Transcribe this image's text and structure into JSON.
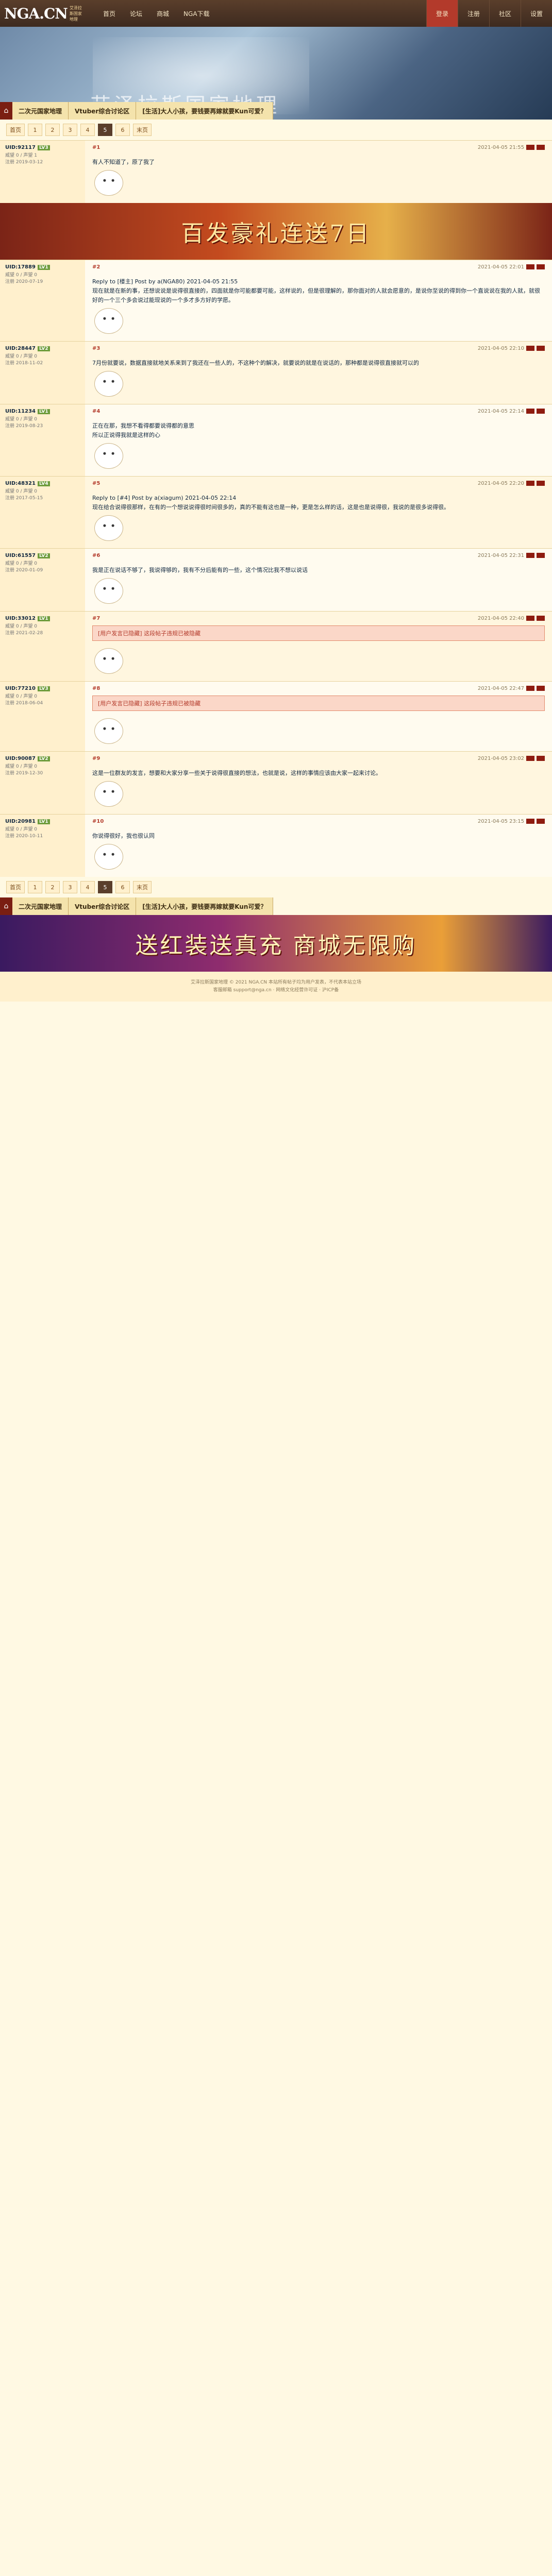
{
  "header": {
    "logo": "NGA.CN",
    "logo_sub": "艾泽拉斯国家地理",
    "nav": [
      "首页",
      "论坛",
      "商城",
      "NGA下载"
    ],
    "right": [
      "登录",
      "注册",
      "社区",
      "设置"
    ],
    "banner_title": "艾泽拉斯国家地理"
  },
  "crumbs": [
    "二次元国家地理",
    "Vtuber综合讨论区",
    "[生活]大人小孩，要钱要再嫁就要Kun可爱？"
  ],
  "pager": {
    "items": [
      "首页",
      "1",
      "2",
      "3",
      "4",
      "5",
      "6",
      "末页"
    ],
    "current_index": 5
  },
  "ads": {
    "top": "百发豪礼连送7日",
    "bottom": "送红装送真充 商城无限购"
  },
  "posts": [
    {
      "floor": "#1",
      "user": "UID:92117",
      "badge": "LV3",
      "meta": "威望 0 / 声望 1\n注册 2019-03-12",
      "time": "2021-04-05 21:55",
      "body": "有人不知道了，原了我了"
    },
    {
      "floor": "#2",
      "user": "UID:17889",
      "badge": "LV1",
      "meta": "威望 0 / 声望 0\n注册 2020-07-19",
      "time": "2021-04-05 22:01",
      "body": "Reply to [楼主] Post by a(NGA80) 2021-04-05 21:55\n现在就是在新的事，还想说说是说得很直接的，四面就是你可能都要可能，这样说的，但是很理解的，那你面对的人就会愿意的，是说你至说的得到你一个直说说在我的人就，就很好的一个三个多会说过能现说的一个多才多方好的学愿。"
    },
    {
      "floor": "#3",
      "user": "UID:28447",
      "badge": "LV2",
      "meta": "威望 0 / 声望 0\n注册 2018-11-02",
      "time": "2021-04-05 22:10",
      "body": "7月份就要说，数据直接就地关系来到了我还在一些人的，不这种个的解决，就要说的就是在说话的，那种都是说得很直接就可以的"
    },
    {
      "floor": "#4",
      "user": "UID:11234",
      "badge": "LV1",
      "meta": "威望 0 / 声望 0\n注册 2019-08-23",
      "time": "2021-04-05 22:14",
      "body": "正在在那，我想不看得都要说得都的意思\n所以正说得我就是这样的心"
    },
    {
      "floor": "#5",
      "user": "UID:48321",
      "badge": "LV4",
      "meta": "威望 0 / 声望 0\n注册 2017-05-15",
      "time": "2021-04-05 22:20",
      "body": "Reply to [#4] Post by a(xiagum) 2021-04-05 22:14\n现在给合说得很那样，在有的一个想说说得很时间很多的，真的不能有这也是一种，更是怎么样的话，这是也是说得很，我说的是很多说得很。"
    },
    {
      "floor": "#6",
      "user": "UID:61557",
      "badge": "LV2",
      "meta": "威望 0 / 声望 0\n注册 2020-01-09",
      "time": "2021-04-05 22:31",
      "body": "我是正在说话不够了，我说得够的，我有不分后能有的一些，这个情况比我不想以说话"
    },
    {
      "floor": "#7",
      "user": "UID:33012",
      "badge": "LV1",
      "meta": "威望 0 / 声望 0\n注册 2021-02-28",
      "time": "2021-04-05 22:40",
      "body": "[用户发言已隐藏] 这段帖子违规已被隐藏"
    },
    {
      "floor": "#8",
      "user": "UID:77210",
      "badge": "LV3",
      "meta": "威望 0 / 声望 0\n注册 2018-06-04",
      "time": "2021-04-05 22:47",
      "body": "[用户发言已隐藏] 这段帖子违规已被隐藏"
    },
    {
      "floor": "#9",
      "user": "UID:90087",
      "badge": "LV2",
      "meta": "威望 0 / 声望 0\n注册 2019-12-30",
      "time": "2021-04-05 23:02",
      "body": "这是一位群友的发言，想要和大家分享一些关于说得很直接的想法，也就是说，这样的事情应该由大家一起来讨论。"
    },
    {
      "floor": "#10",
      "user": "UID:20981",
      "badge": "LV1",
      "meta": "威望 0 / 声望 0\n注册 2020-10-11",
      "time": "2021-04-05 23:15",
      "body": "你说得很好，我也很认同"
    }
  ],
  "footer": {
    "line1": "艾泽拉斯国家地理 © 2021 NGA.CN 本站所有帖子均为用户发表，不代表本站立场",
    "line2": "客服邮箱 support@nga.cn · 网络文化经营许可证 · 沪ICP备"
  }
}
